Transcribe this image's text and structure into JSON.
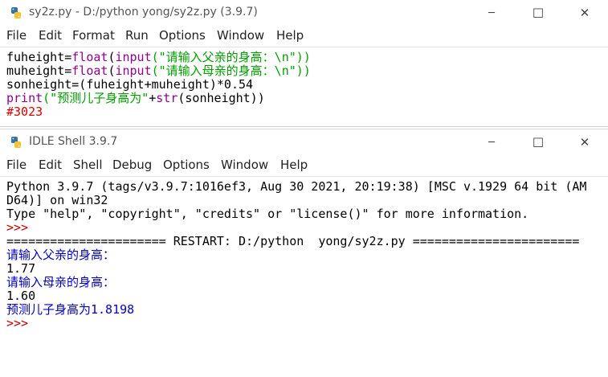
{
  "editor": {
    "title": "sy2z.py - D:/python  yong/sy2z.py (3.9.7)",
    "menu": [
      "File",
      "Edit",
      "Format",
      "Run",
      "Options",
      "Window",
      "Help"
    ],
    "lines": [
      [
        {
          "t": "fuheight=",
          "c": ""
        },
        {
          "t": "float",
          "c": "k"
        },
        {
          "t": "(",
          "c": ""
        },
        {
          "t": "input",
          "c": "k"
        },
        {
          "t": "(\"请输入父亲的身高：\\n\"))",
          "c": "s"
        }
      ],
      [
        {
          "t": "muheight=",
          "c": ""
        },
        {
          "t": "float",
          "c": "k"
        },
        {
          "t": "(",
          "c": ""
        },
        {
          "t": "input",
          "c": "k"
        },
        {
          "t": "(\"请输入母亲的身高：\\n\"))",
          "c": "s"
        }
      ],
      [
        {
          "t": "sonheight=(fuheight+muheight)*0.54",
          "c": ""
        }
      ],
      [
        {
          "t": "print",
          "c": "k"
        },
        {
          "t": "(\"预测儿子身高为\"",
          "c": "s"
        },
        {
          "t": "+",
          "c": ""
        },
        {
          "t": "str",
          "c": "k"
        },
        {
          "t": "(sonheight))",
          "c": ""
        }
      ],
      [
        {
          "t": "#3023",
          "c": "c"
        }
      ]
    ]
  },
  "shell": {
    "title": "IDLE Shell 3.9.7",
    "menu": [
      "File",
      "Edit",
      "Shell",
      "Debug",
      "Options",
      "Window",
      "Help"
    ],
    "lines": [
      [
        {
          "t": "Python 3.9.7 (tags/v3.9.7:1016ef3, Aug 30 2021, 20:19:38) [MSC v.1929 64 bit (AM",
          "c": ""
        }
      ],
      [
        {
          "t": "D64)] on win32",
          "c": ""
        }
      ],
      [
        {
          "t": "Type \"help\", \"copyright\", \"credits\" or \"license()\" for more information.",
          "c": ""
        }
      ],
      [
        {
          "t": ">>>",
          "c": "p"
        }
      ],
      [
        {
          "t": "====================== RESTART: D:/python  yong/sy2z.py =======================",
          "c": ""
        }
      ],
      [
        {
          "t": "请输入父亲的身高：",
          "c": "o"
        }
      ],
      [
        {
          "t": "1.77",
          "c": ""
        }
      ],
      [
        {
          "t": "请输入母亲的身高：",
          "c": "o"
        }
      ],
      [
        {
          "t": "1.60",
          "c": ""
        }
      ],
      [
        {
          "t": "预测儿子身高为1.8198",
          "c": "o"
        }
      ],
      [
        {
          "t": ">>>",
          "c": "p"
        }
      ]
    ]
  },
  "window_controls": {
    "minimize": "─",
    "maximize": "☐",
    "close": "✕"
  }
}
